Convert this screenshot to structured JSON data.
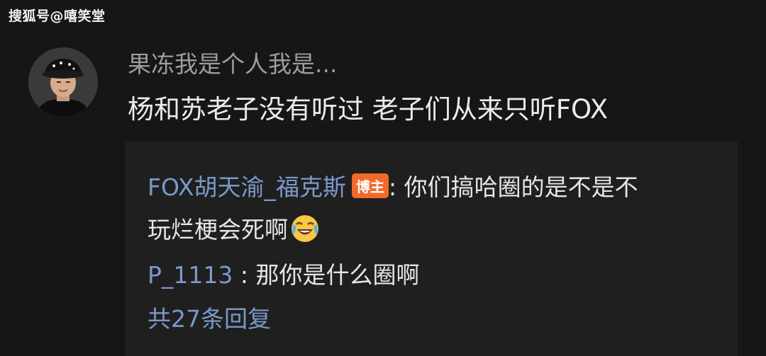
{
  "watermark": "搜狐号@嘻笑堂",
  "comment": {
    "username": "果冻我是个人我是...",
    "text": "杨和苏老子没有听过 老子们从来只听FOX"
  },
  "replies": [
    {
      "author": "FOX胡天渝_福克斯",
      "badge": "博主",
      "separator": ": ",
      "text_line1": "你们搞哈圈的是不是不",
      "text_line2": "玩烂梗会死啊",
      "emoji": "laughing-crying-emoji"
    },
    {
      "author": "P_1113",
      "separator": " : ",
      "text": "那你是什么圈啊"
    }
  ],
  "more_replies": "共27条回复"
}
